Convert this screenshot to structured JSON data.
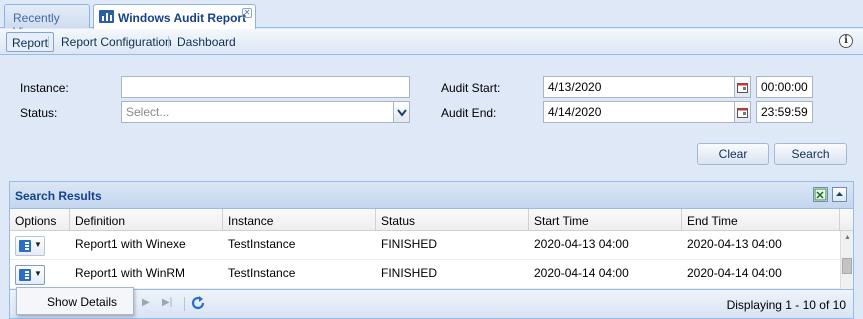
{
  "tabs": [
    {
      "label": "Recently View",
      "active": false
    },
    {
      "label": "Windows Audit Report",
      "active": true,
      "close_icon": "close-icon"
    }
  ],
  "toolbar": {
    "items": [
      "Report",
      "Report Configuration",
      "Dashboard"
    ],
    "pressed": "Report",
    "help_icon": "info-icon",
    "help_glyph": "i"
  },
  "filters": {
    "instance_label": "Instance:",
    "instance_value": "",
    "status_label": "Status:",
    "status_placeholder": "Select...",
    "audit_start_label": "Audit Start:",
    "audit_start_date": "4/13/2020",
    "audit_start_time": "00:00:00",
    "audit_end_label": "Audit End:",
    "audit_end_date": "4/14/2020",
    "audit_end_time": "23:59:59"
  },
  "buttons": {
    "clear": "Clear",
    "search": "Search"
  },
  "results": {
    "title": "Search Results",
    "columns": [
      "Options",
      "Definition",
      "Instance",
      "Status",
      "Start Time",
      "End Time"
    ],
    "rows": [
      {
        "definition": "Report1 with Winexe",
        "instance": "TestInstance",
        "status": "FINISHED",
        "start": "2020-04-13 04:00",
        "end": "2020-04-13 04:00"
      },
      {
        "definition": "Report1 with WinRM",
        "instance": "TestInstance",
        "status": "FINISHED",
        "start": "2020-04-14 04:00",
        "end": "2020-04-14 04:00"
      }
    ],
    "paging": "Displaying 1 - 10 of 10"
  },
  "context_menu": {
    "items": [
      "Show Details"
    ]
  },
  "colors": {
    "header_blue": "#15428b",
    "border_blue": "#99bbe8",
    "icon_blue": "#2b6fc5"
  }
}
